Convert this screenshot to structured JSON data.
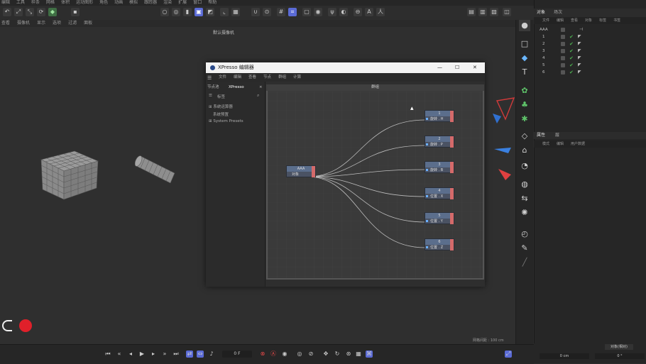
{
  "menubar": {
    "items": [
      "编辑",
      "工具",
      "样条",
      "网格",
      "体积",
      "运动图形",
      "角色",
      "动画",
      "模拟",
      "跟踪器",
      "渲染",
      "扩展",
      "窗口",
      "帮助"
    ]
  },
  "subbar": {
    "items": [
      "查看",
      "摄像机",
      "显示",
      "选项",
      "过滤",
      "面板"
    ]
  },
  "viewport": {
    "title": "默认摄像机",
    "footer": "网格间距 : 100 cm"
  },
  "xpresso": {
    "title": "XPresso 编辑器",
    "menu": [
      "文件",
      "编辑",
      "查看",
      "节点",
      "群组",
      "计算"
    ],
    "left_tabs": [
      "节点池",
      "XPresso"
    ],
    "left_header": "标签",
    "tree": [
      "系统运算器",
      "系统预置",
      "System Presets"
    ],
    "canvas_title": "群组",
    "source_node": {
      "title": "AAA",
      "port": "对象"
    },
    "target_nodes": [
      {
        "title": "1",
        "port": "旋转 . H"
      },
      {
        "title": "2",
        "port": "旋转 . P"
      },
      {
        "title": "3",
        "port": "旋转 . B"
      },
      {
        "title": "4",
        "port": "位置 . X"
      },
      {
        "title": "5",
        "port": "位置 . Y"
      },
      {
        "title": "6",
        "port": "位置 . Z"
      }
    ],
    "controls": {
      "minimize": "—",
      "maximize": "☐",
      "close": "✕"
    }
  },
  "objects_panel": {
    "tabs": [
      "对象",
      "场次"
    ],
    "menu": [
      "文件",
      "编辑",
      "查看",
      "对象",
      "标签",
      "书签"
    ],
    "rows": [
      {
        "name": "AAA"
      },
      {
        "name": "1"
      },
      {
        "name": "2"
      },
      {
        "name": "3"
      },
      {
        "name": "4"
      },
      {
        "name": "5"
      },
      {
        "name": "6"
      }
    ]
  },
  "attributes_panel": {
    "tabs": [
      "属性",
      "层"
    ],
    "menu": [
      "模式",
      "编辑",
      "用户数据"
    ]
  },
  "coords": {
    "button": "对象(相对)",
    "x_value": "0 cm",
    "y_value": "0 °"
  },
  "timeline": {
    "frame": "0 F"
  },
  "icons": {
    "play": "play-icon",
    "record": "record-icon",
    "cube": "cube-icon"
  }
}
